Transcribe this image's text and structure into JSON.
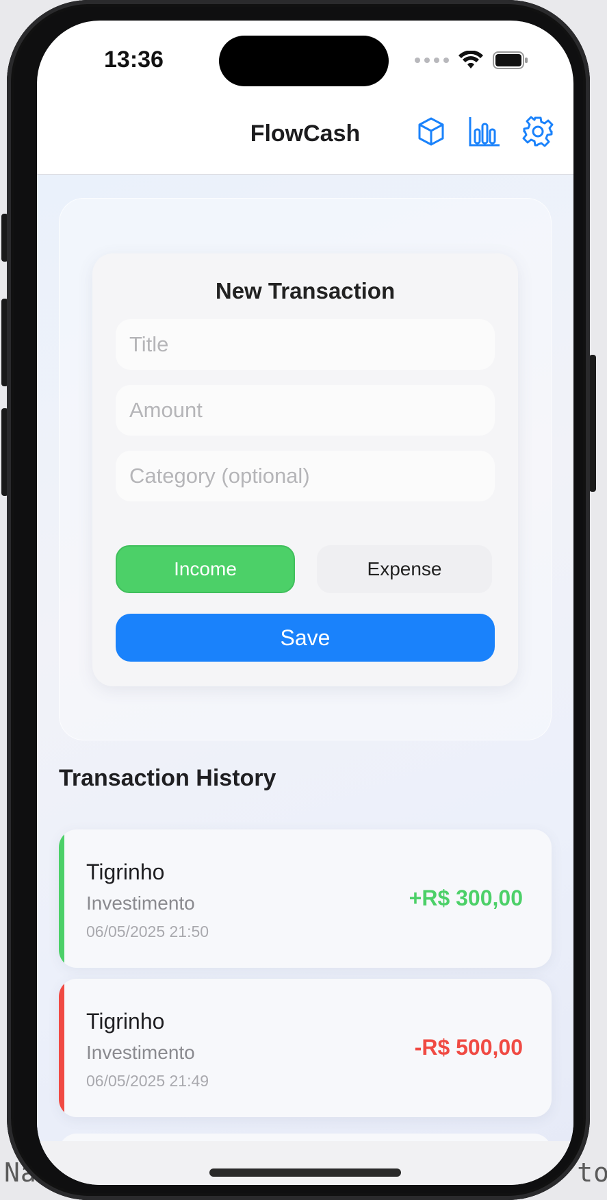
{
  "status_bar": {
    "time": "13:36"
  },
  "nav": {
    "title": "FlowCash",
    "icons": [
      "cube-icon",
      "bar-chart-icon",
      "gear-icon"
    ]
  },
  "form": {
    "title": "New Transaction",
    "title_placeholder": "Title",
    "amount_placeholder": "Amount",
    "category_placeholder": "Category (optional)",
    "income_label": "Income",
    "expense_label": "Expense",
    "selected_type": "Income",
    "save_label": "Save"
  },
  "history": {
    "title": "Transaction History",
    "items": [
      {
        "title": "Tigrinho",
        "category": "Investimento",
        "date": "06/05/2025 21:50",
        "amount": "+R$ 300,00",
        "type": "income"
      },
      {
        "title": "Tigrinho",
        "category": "Investimento",
        "date": "06/05/2025 21:49",
        "amount": "-R$ 500,00",
        "type": "expense"
      }
    ]
  },
  "background_text": {
    "left": "Na",
    "right": "to"
  },
  "colors": {
    "accent": "#1a82fb",
    "income": "#4cd068",
    "expense": "#f04a43"
  }
}
